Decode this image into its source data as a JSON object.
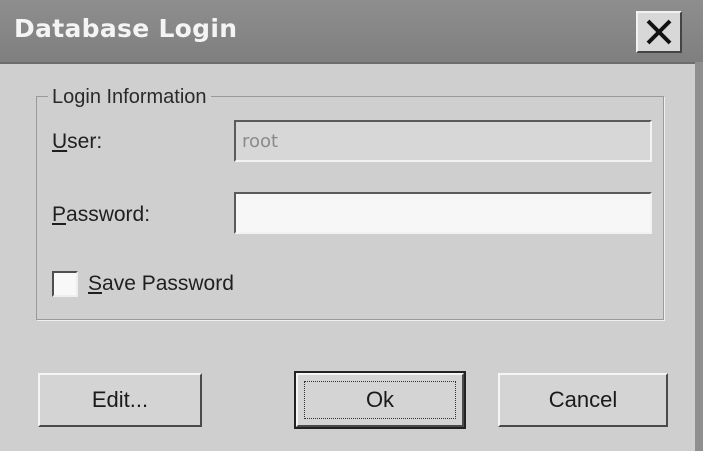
{
  "window": {
    "title": "Database Login"
  },
  "group": {
    "legend": "Login Information"
  },
  "user": {
    "label_mnemonic": "U",
    "label_rest": "ser:",
    "value": "root"
  },
  "password": {
    "label_mnemonic": "P",
    "label_rest": "assword:",
    "value": ""
  },
  "save_password": {
    "mnemonic": "S",
    "label_rest": "ave Password",
    "checked": false
  },
  "buttons": {
    "edit": "Edit...",
    "ok": "Ok",
    "cancel": "Cancel"
  },
  "icons": {
    "close": "close-icon"
  }
}
